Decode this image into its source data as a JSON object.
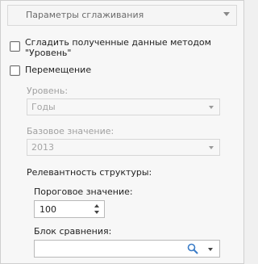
{
  "section": {
    "title": "Параметры сглаживания"
  },
  "smooth": {
    "label_line1": "Сгладить полученные данные методом",
    "label_line2": "\"Уровень\"",
    "checked": false
  },
  "move": {
    "label": "Перемещение",
    "checked": false
  },
  "level": {
    "label": "Уровень:",
    "value": "Годы"
  },
  "base_value": {
    "label": "Базовое значение:",
    "value": "2013"
  },
  "relevance": {
    "label": "Релевантность структуры:"
  },
  "threshold": {
    "label": "Пороговое значение:",
    "value": "100"
  },
  "compare_block": {
    "label": "Блок сравнения:",
    "value": ""
  },
  "icons": {
    "header": "chevron-down-icon",
    "search": "search-icon"
  }
}
